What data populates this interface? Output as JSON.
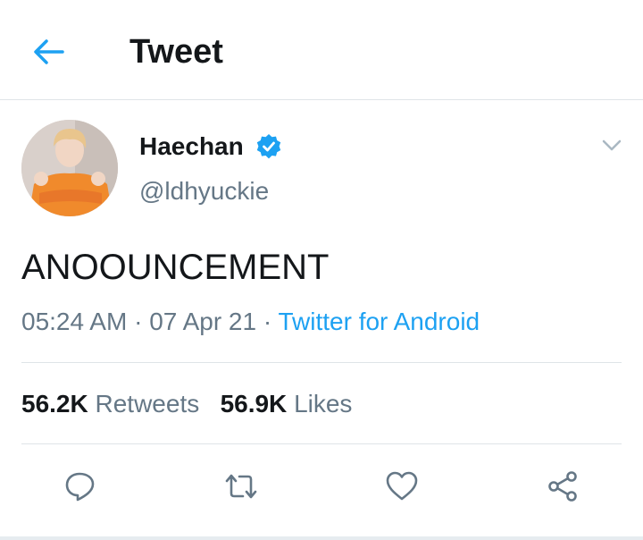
{
  "header": {
    "title": "Tweet",
    "back_icon": "arrow-left-icon"
  },
  "tweet": {
    "author_name": "Haechan",
    "verified": true,
    "handle": "@ldhyuckie",
    "text": "ANOOUNCEMENT",
    "time": "05:24 AM",
    "date": "07 Apr 21",
    "source": "Twitter for Android",
    "separator": "·",
    "retweets_count": "56.2K",
    "retweets_label": "Retweets",
    "likes_count": "56.9K",
    "likes_label": "Likes"
  },
  "actions": [
    {
      "icon": "reply-icon"
    },
    {
      "icon": "retweet-icon"
    },
    {
      "icon": "like-icon"
    },
    {
      "icon": "share-icon"
    }
  ],
  "colors": {
    "accent": "#1da1f2",
    "text": "#14171a",
    "secondary": "#657786",
    "divider": "#dfe4e8"
  }
}
